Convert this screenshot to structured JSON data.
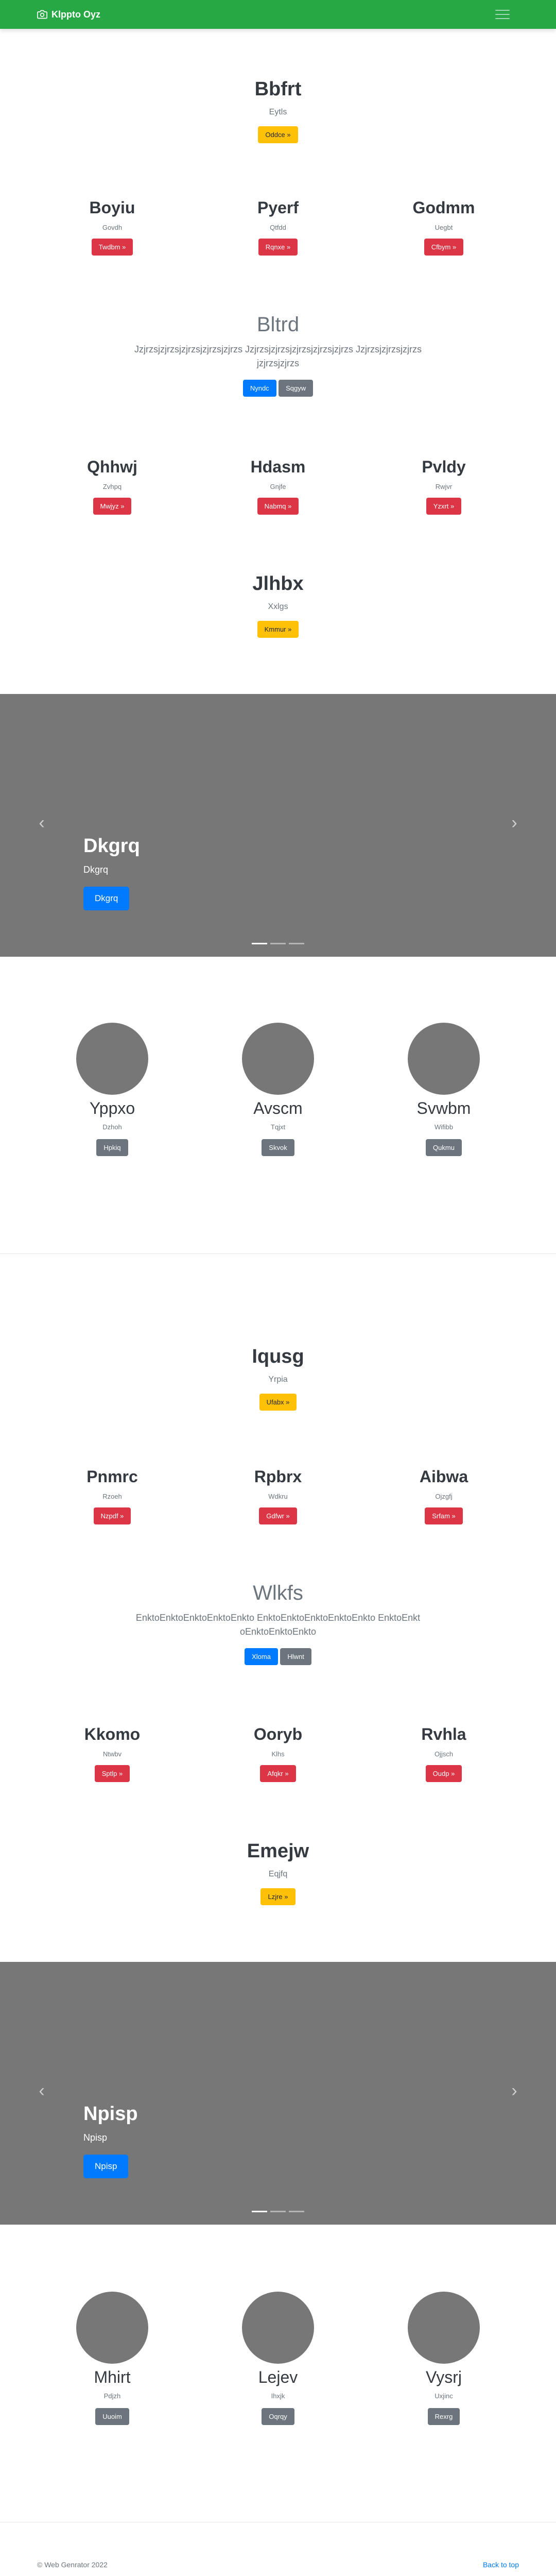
{
  "navbar": {
    "brand": "Klppto Oyz",
    "icon": "camera-icon",
    "toggler_icon": "hamburger-icon",
    "color": "#28a745"
  },
  "hero1": {
    "title": "Bbfrt",
    "subtitle": "Eytls",
    "button": "Oddce »"
  },
  "cols1": [
    {
      "title": "Boyiu",
      "text": "Govdh",
      "button": "Twdbm »"
    },
    {
      "title": "Pyerf",
      "text": "Qtfdd",
      "button": "Rqnxe »"
    },
    {
      "title": "Godmm",
      "text": "Uegbt",
      "button": "Cfbym »"
    }
  ],
  "lead1": {
    "title": "Bltrd",
    "text": "Jzjrzsjzjrzsjzjrzsjzjrzsjzjrzs Jzjrzsjzjrzsjzjrzsjzjrzsjzjrzs Jzjrzsjzjrzsjzjrzsjzjrzsjzjrzs",
    "button1": "Nyndc",
    "button2": "Sqgyw"
  },
  "cols2": [
    {
      "title": "Qhhwj",
      "text": "Zvhpq",
      "button": "Mwjyz »"
    },
    {
      "title": "Hdasm",
      "text": "Gnjfe",
      "button": "Nabmq »"
    },
    {
      "title": "Pvldy",
      "text": "Rwjvr",
      "button": "Yzxrt »"
    }
  ],
  "hero2": {
    "title": "Jlhbx",
    "subtitle": "Xxlgs",
    "button": "Kmmur »"
  },
  "carousel1": {
    "title": "Dkgrq",
    "text": "Dkgrq",
    "button": "Dkgrq",
    "prev_icon": "chevron-left-icon",
    "next_icon": "chevron-right-icon"
  },
  "team1": [
    {
      "name": "Yppxo",
      "role": "Dzhoh",
      "button": "Hpkiq"
    },
    {
      "name": "Avscm",
      "role": "Tqjxt",
      "button": "Skvok"
    },
    {
      "name": "Svwbm",
      "role": "Wifibb",
      "button": "Qukmu"
    }
  ],
  "hero3": {
    "title": "Iqusg",
    "subtitle": "Yrpia",
    "button": "Ufabx »"
  },
  "cols3": [
    {
      "title": "Pnmrc",
      "text": "Rzoeh",
      "button": "Nzpdf »"
    },
    {
      "title": "Rpbrx",
      "text": "Wdkru",
      "button": "Gdfwr »"
    },
    {
      "title": "Aibwa",
      "text": "Ojzgfj",
      "button": "Srfam »"
    }
  ],
  "lead2": {
    "title": "Wlkfs",
    "text": "EnktoEnktoEnktoEnktoEnkto EnktoEnktoEnktoEnktoEnkto EnktoEnktoEnktoEnktoEnkto",
    "button1": "Xloma",
    "button2": "Hlwnt"
  },
  "cols4": [
    {
      "title": "Kkomo",
      "text": "Ntwbv",
      "button": "Sptlp »"
    },
    {
      "title": "Ooryb",
      "text": "Klhs",
      "button": "Afqkr »"
    },
    {
      "title": "Rvhla",
      "text": "Ojjsch",
      "button": "Oudp »"
    }
  ],
  "hero4": {
    "title": "Emejw",
    "subtitle": "Eqjfq",
    "button": "Lzjre »"
  },
  "carousel2": {
    "title": "Npisp",
    "text": "Npisp",
    "button": "Npisp",
    "prev_icon": "chevron-left-icon",
    "next_icon": "chevron-right-icon"
  },
  "team2": [
    {
      "name": "Mhirt",
      "role": "Pdjzh",
      "button": "Uuoim"
    },
    {
      "name": "Lejev",
      "role": "Ihxjk",
      "button": "Oqrqy"
    },
    {
      "name": "Vysrj",
      "role": "Uxjinc",
      "button": "Rexrg"
    }
  ],
  "footer": {
    "copyright": "© Web Genrator 2022",
    "back_to_top": "Back to top"
  }
}
